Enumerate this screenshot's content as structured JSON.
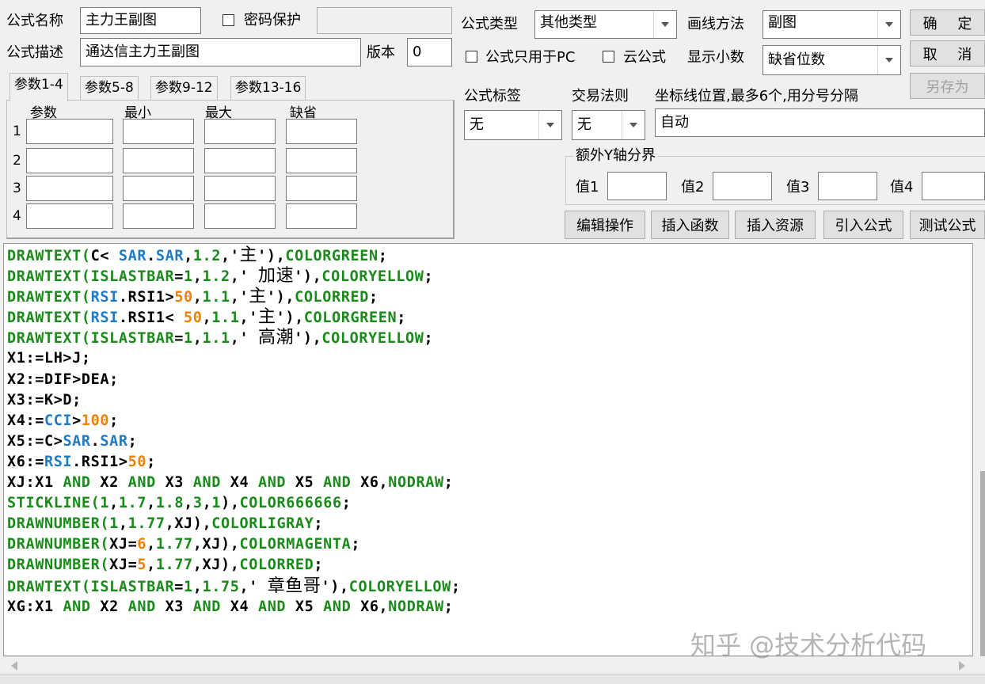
{
  "formula_name_label": "公式名称",
  "formula_name_value": "主力王副图",
  "password_protect_label": "密码保护",
  "password_value": "",
  "formula_desc_label": "公式描述",
  "formula_desc_value": "通达信主力王副图",
  "version_label": "版本",
  "version_value": "0",
  "formula_type_label": "公式类型",
  "formula_type_value": "其他类型",
  "draw_method_label": "画线方法",
  "draw_method_value": "副图",
  "pc_only_label": "公式只用于PC",
  "cloud_label": "云公式",
  "decimals_label": "显示小数",
  "decimals_value": "缺省位数",
  "buttons": {
    "ok": "确 定",
    "cancel": "取 消",
    "save_as": "另存为",
    "edit_ops": "编辑操作",
    "insert_func": "插入函数",
    "insert_res": "插入资源",
    "import_formula": "引入公式",
    "test_formula": "测试公式"
  },
  "tabs": [
    "参数1-4",
    "参数5-8",
    "参数9-12",
    "参数13-16"
  ],
  "param_headers": [
    "参数",
    "最小",
    "最大",
    "缺省"
  ],
  "param_rows": [
    "1",
    "2",
    "3",
    "4"
  ],
  "formula_tag_label": "公式标签",
  "formula_tag_value": "无",
  "trade_rule_label": "交易法则",
  "trade_rule_value": "无",
  "axis_label": "坐标线位置,最多6个,用分号分隔",
  "axis_value": "自动",
  "extra_y_label": "额外Y轴分界",
  "extra_y": [
    "值1",
    "值2",
    "值3",
    "值4"
  ],
  "code_lines": [
    [
      [
        "g",
        "DRAWTEXT("
      ],
      [
        "k",
        "C< "
      ],
      [
        "b",
        "SAR"
      ],
      [
        "k",
        "."
      ],
      [
        "b",
        "SAR"
      ],
      [
        "k",
        ","
      ],
      [
        "g",
        "1.2"
      ],
      [
        "k",
        ",'"
      ],
      [
        "cn",
        "主"
      ],
      [
        "k",
        "'),"
      ],
      [
        "g",
        "COLORGREEN"
      ],
      [
        "k",
        ";"
      ]
    ],
    [
      [
        "g",
        "DRAWTEXT(ISLASTBAR"
      ],
      [
        "k",
        "="
      ],
      [
        "g",
        "1"
      ],
      [
        "k",
        ","
      ],
      [
        "g",
        "1.2"
      ],
      [
        "k",
        ",' "
      ],
      [
        "cn",
        "加速"
      ],
      [
        "k",
        "'),"
      ],
      [
        "g",
        "COLORYELLOW"
      ],
      [
        "k",
        ";"
      ]
    ],
    [
      [
        "g",
        "DRAWTEXT("
      ],
      [
        "b",
        "RSI"
      ],
      [
        "k",
        ".RSI1>"
      ],
      [
        "o",
        "50"
      ],
      [
        "k",
        ","
      ],
      [
        "g",
        "1.1"
      ],
      [
        "k",
        ",'"
      ],
      [
        "cn",
        "主"
      ],
      [
        "k",
        "'),"
      ],
      [
        "g",
        "COLORRED"
      ],
      [
        "k",
        ";"
      ]
    ],
    [
      [
        "g",
        "DRAWTEXT("
      ],
      [
        "b",
        "RSI"
      ],
      [
        "k",
        ".RSI1< "
      ],
      [
        "o",
        "50"
      ],
      [
        "k",
        ","
      ],
      [
        "g",
        "1.1"
      ],
      [
        "k",
        ",'"
      ],
      [
        "cn",
        "主"
      ],
      [
        "k",
        "'),"
      ],
      [
        "g",
        "COLORGREEN"
      ],
      [
        "k",
        ";"
      ]
    ],
    [
      [
        "g",
        "DRAWTEXT(ISLASTBAR"
      ],
      [
        "k",
        "="
      ],
      [
        "g",
        "1"
      ],
      [
        "k",
        ","
      ],
      [
        "g",
        "1.1"
      ],
      [
        "k",
        ",' "
      ],
      [
        "cn",
        "高潮"
      ],
      [
        "k",
        "'),"
      ],
      [
        "g",
        "COLORYELLOW"
      ],
      [
        "k",
        ";"
      ]
    ],
    [
      [
        "k",
        "X1:=LH>J;"
      ]
    ],
    [
      [
        "k",
        "X2:=DIF>DEA;"
      ]
    ],
    [
      [
        "k",
        "X3:=K>D;"
      ]
    ],
    [
      [
        "k",
        "X4:="
      ],
      [
        "b",
        "CCI"
      ],
      [
        "k",
        ">"
      ],
      [
        "o",
        "100"
      ],
      [
        "k",
        ";"
      ]
    ],
    [
      [
        "k",
        "X5:=C>"
      ],
      [
        "b",
        "SAR"
      ],
      [
        "k",
        "."
      ],
      [
        "b",
        "SAR"
      ],
      [
        "k",
        ";"
      ]
    ],
    [
      [
        "k",
        "X6:="
      ],
      [
        "b",
        "RSI"
      ],
      [
        "k",
        ".RSI1>"
      ],
      [
        "o",
        "50"
      ],
      [
        "k",
        ";"
      ]
    ],
    [
      [
        "k",
        "XJ:X1 "
      ],
      [
        "g",
        "AND"
      ],
      [
        "k",
        " X2 "
      ],
      [
        "g",
        "AND"
      ],
      [
        "k",
        " X3 "
      ],
      [
        "g",
        "AND"
      ],
      [
        "k",
        " X4 "
      ],
      [
        "g",
        "AND"
      ],
      [
        "k",
        " X5 "
      ],
      [
        "g",
        "AND"
      ],
      [
        "k",
        " X6,"
      ],
      [
        "g",
        "NODRAW"
      ],
      [
        "k",
        ";"
      ]
    ],
    [
      [
        "g",
        "STICKLINE("
      ],
      [
        "g",
        "1"
      ],
      [
        "k",
        ","
      ],
      [
        "g",
        "1.7"
      ],
      [
        "k",
        ","
      ],
      [
        "g",
        "1.8"
      ],
      [
        "k",
        ","
      ],
      [
        "g",
        "3"
      ],
      [
        "k",
        ","
      ],
      [
        "g",
        "1"
      ],
      [
        "k",
        "),"
      ],
      [
        "g",
        "COLOR666666"
      ],
      [
        "k",
        ";"
      ]
    ],
    [
      [
        "g",
        "DRAWNUMBER("
      ],
      [
        "g",
        "1"
      ],
      [
        "k",
        ","
      ],
      [
        "g",
        "1.77"
      ],
      [
        "k",
        ",XJ),"
      ],
      [
        "g",
        "COLORLIGRAY"
      ],
      [
        "k",
        ";"
      ]
    ],
    [
      [
        "g",
        "DRAWNUMBER("
      ],
      [
        "k",
        "XJ="
      ],
      [
        "o",
        "6"
      ],
      [
        "k",
        ","
      ],
      [
        "g",
        "1.77"
      ],
      [
        "k",
        ",XJ),"
      ],
      [
        "g",
        "COLORMAGENTA"
      ],
      [
        "k",
        ";"
      ]
    ],
    [
      [
        "g",
        "DRAWNUMBER("
      ],
      [
        "k",
        "XJ="
      ],
      [
        "o",
        "5"
      ],
      [
        "k",
        ","
      ],
      [
        "g",
        "1.77"
      ],
      [
        "k",
        ",XJ),"
      ],
      [
        "g",
        "COLORRED"
      ],
      [
        "k",
        ";"
      ]
    ],
    [
      [
        "g",
        "DRAWTEXT(ISLASTBAR"
      ],
      [
        "k",
        "="
      ],
      [
        "g",
        "1"
      ],
      [
        "k",
        ","
      ],
      [
        "g",
        "1.75"
      ],
      [
        "k",
        ",' "
      ],
      [
        "cn",
        "章鱼哥"
      ],
      [
        "k",
        "'),"
      ],
      [
        "g",
        "COLORYELLOW"
      ],
      [
        "k",
        ";"
      ]
    ],
    [
      [
        "k",
        "XG:X1 "
      ],
      [
        "g",
        "AND"
      ],
      [
        "k",
        " X2 "
      ],
      [
        "g",
        "AND"
      ],
      [
        "k",
        " X3 "
      ],
      [
        "g",
        "AND"
      ],
      [
        "k",
        " X4 "
      ],
      [
        "g",
        "AND"
      ],
      [
        "k",
        " X5 "
      ],
      [
        "g",
        "AND"
      ],
      [
        "k",
        " X6,"
      ],
      [
        "g",
        "NODRAW"
      ],
      [
        "k",
        ";"
      ]
    ]
  ],
  "watermark": "知乎 @技术分析代码"
}
